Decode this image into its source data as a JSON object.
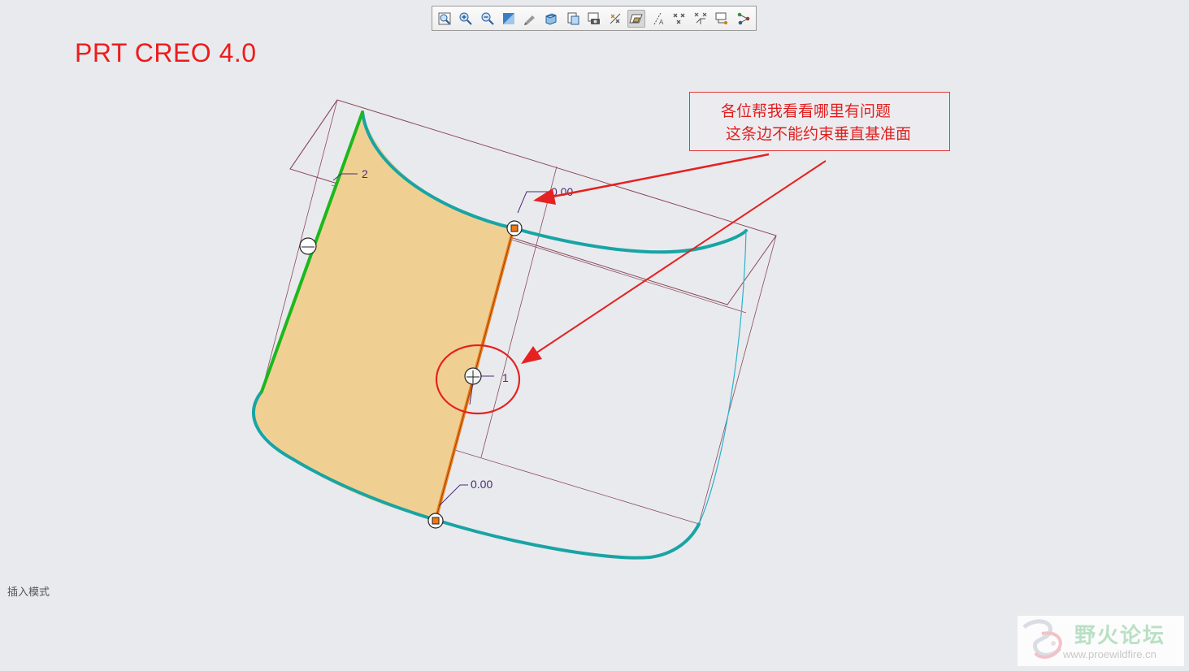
{
  "app_title": "PRT CREO 4.0",
  "toolbar": {
    "buttons": [
      {
        "name": "refit-icon",
        "active": false
      },
      {
        "name": "zoom-in-icon",
        "active": false
      },
      {
        "name": "zoom-out-icon",
        "active": false
      },
      {
        "name": "repaint-icon",
        "active": false
      },
      {
        "name": "reorient-icon",
        "active": false
      },
      {
        "name": "saved-views-icon",
        "active": false
      },
      {
        "name": "display-style-icon",
        "active": false
      },
      {
        "name": "view-manager-icon",
        "active": false
      },
      {
        "name": "datum-display-icon",
        "active": false
      },
      {
        "name": "plane-display-icon",
        "active": true
      },
      {
        "name": "axis-display-icon",
        "active": false
      },
      {
        "name": "point-display-icon",
        "active": false
      },
      {
        "name": "csys-display-icon",
        "active": false
      },
      {
        "name": "annotation-display-icon",
        "active": false
      },
      {
        "name": "spin-center-icon",
        "active": false
      }
    ]
  },
  "annotation": {
    "line1": "各位帮我看看哪里有问题",
    "line2": "这条边不能约束垂直基准面"
  },
  "dimensions": {
    "d_top": "0.00",
    "d_bottom": "0.00",
    "label_1": "1",
    "label_2": "2"
  },
  "status_bar": {
    "mode_text": "插入模式"
  },
  "watermark": {
    "title": "野火论坛",
    "url": "www.proewildfire.cn"
  },
  "colors": {
    "surface_fill": "#f0d092",
    "boundary_teal": "#19a4a4",
    "green_edge": "#1db81d",
    "orange_edge": "#f07818",
    "annotation_red": "#e52121",
    "datum_plane": "#8a4a5a"
  }
}
